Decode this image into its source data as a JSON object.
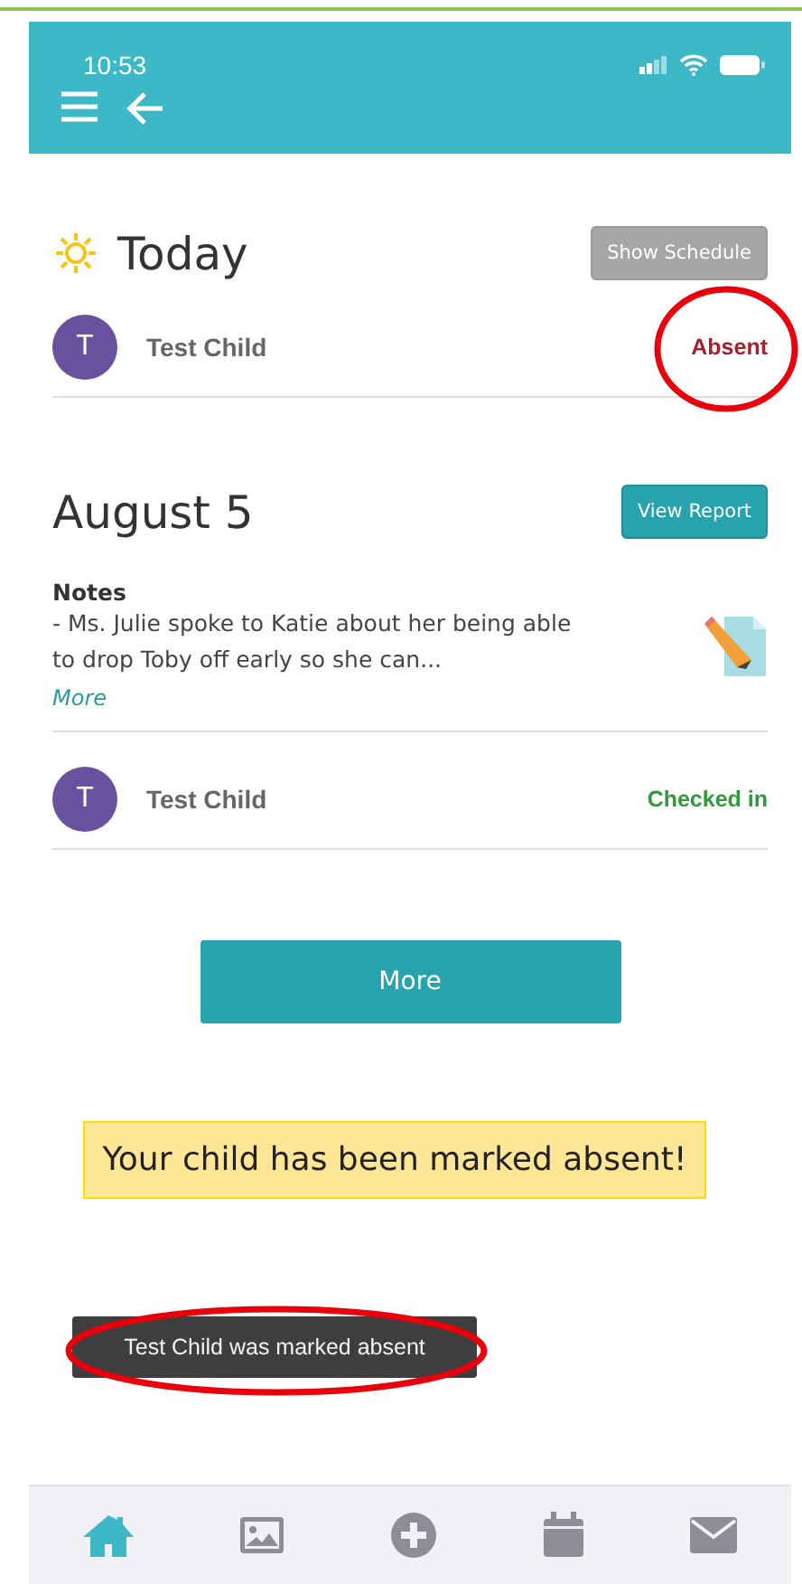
{
  "status_bar": {
    "time": "10:53"
  },
  "today": {
    "title": "Today",
    "button": "Show Schedule",
    "children": [
      {
        "initial": "T",
        "name": "Test Child",
        "status": "Absent",
        "color": "#a3222f"
      }
    ]
  },
  "day": {
    "title": "August 5",
    "button": "View Report",
    "notes": {
      "heading": "Notes",
      "text": "- Ms. Julie spoke to Katie about her being able to drop Toby off early so she can...",
      "more": "More"
    },
    "children": [
      {
        "initial": "T",
        "name": "Test Child",
        "status": "Checked in",
        "color": "#2e9a3a"
      }
    ]
  },
  "more_button": "More",
  "banner": "Your child has been marked absent!",
  "toast": "Test Child was marked absent",
  "tabs": [
    {
      "kind": "home",
      "selected": true
    },
    {
      "kind": "photos",
      "selected": false
    },
    {
      "kind": "add",
      "selected": false
    },
    {
      "kind": "calendar",
      "selected": false
    },
    {
      "kind": "messages",
      "selected": false
    }
  ]
}
